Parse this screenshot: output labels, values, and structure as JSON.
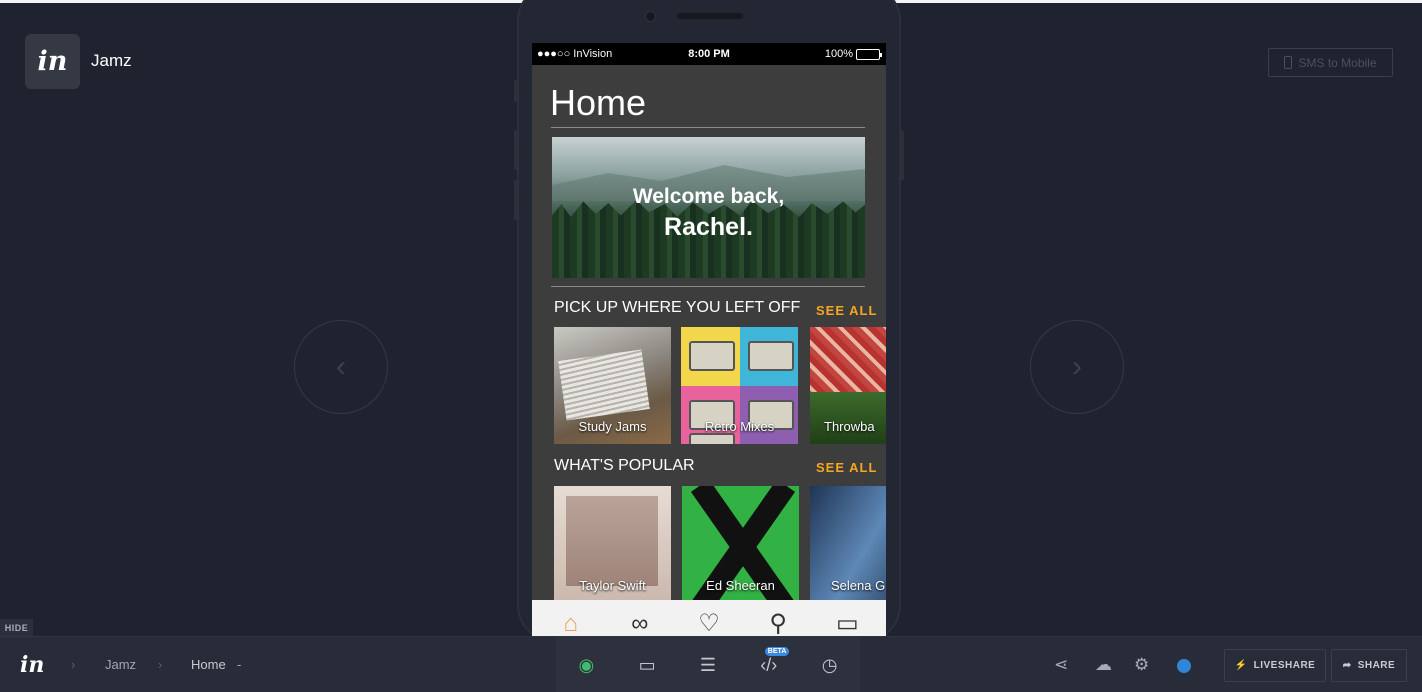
{
  "app": {
    "project_name": "Jamz",
    "logo_text": "in",
    "sms_button_label": "SMS to Mobile"
  },
  "device": {
    "status_bar": {
      "carrier": "●●●○○ InVision",
      "time": "8:00 PM",
      "battery": "100%"
    },
    "screen": {
      "title": "Home",
      "hero": {
        "greeting": "Welcome back,",
        "name": "Rachel."
      },
      "sections": [
        {
          "title": "PICK UP WHERE YOU LEFT OFF",
          "see_all": "SEE ALL",
          "items": [
            "Study Jams",
            "Retro Mixes",
            "Throwba"
          ]
        },
        {
          "title": "WHAT'S POPULAR",
          "see_all": "SEE ALL",
          "items": [
            "Taylor Swift",
            "Ed Sheeran",
            "Selena G"
          ]
        }
      ],
      "tab_icons": [
        "home-icon",
        "binoculars-icon",
        "heart-icon",
        "search-icon",
        "book-icon"
      ]
    }
  },
  "hide_label": "HIDE",
  "bottom_bar": {
    "logo_text": "in",
    "breadcrumb": [
      "Jamz",
      "Home"
    ],
    "dropdown_glyph": "-",
    "tools": [
      "preview-icon",
      "comment-mode-icon",
      "comments-icon",
      "inspect-icon",
      "history-icon"
    ],
    "beta_badge": "BETA",
    "liveshare_label": "LIVESHARE",
    "share_label": "SHARE",
    "colors": {
      "accent_green": "#3fbb6a",
      "accent_blue": "#2f86d8",
      "see_all_orange": "#f5a623"
    }
  }
}
